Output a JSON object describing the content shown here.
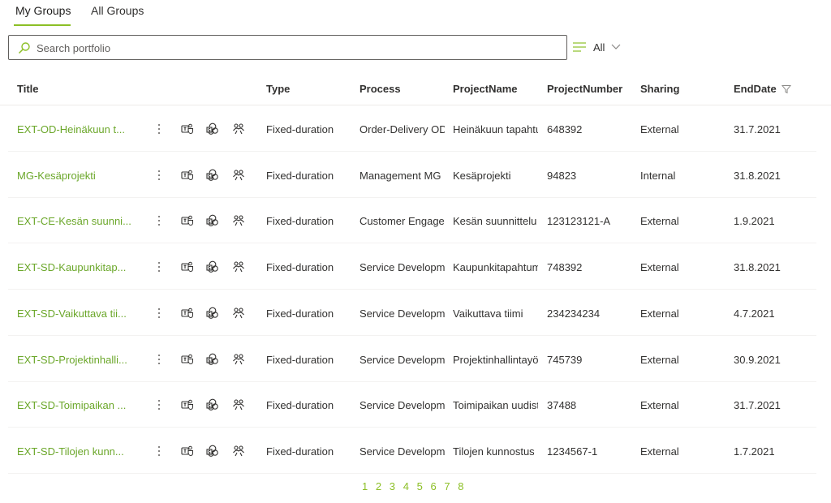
{
  "tabs": [
    {
      "label": "My Groups",
      "active": true
    },
    {
      "label": "All Groups",
      "active": false
    }
  ],
  "search": {
    "placeholder": "Search portfolio",
    "icon": "search-icon"
  },
  "filter": {
    "label": "All"
  },
  "columns": {
    "title": "Title",
    "type": "Type",
    "process": "Process",
    "project_name": "ProjectName",
    "project_number": "ProjectNumber",
    "sharing": "Sharing",
    "end_date": "EndDate"
  },
  "rows": [
    {
      "title": "EXT-OD-Heinäkuun t...",
      "type": "Fixed-duration",
      "process": "Order-Delivery OD",
      "project_name": "Heinäkuun tapahtuma",
      "project_number": "648392",
      "sharing": "External",
      "end_date": "31.7.2021"
    },
    {
      "title": "MG-Kesäprojekti",
      "type": "Fixed-duration",
      "process": "Management MG",
      "project_name": "Kesäprojekti",
      "project_number": "94823",
      "sharing": "Internal",
      "end_date": "31.8.2021"
    },
    {
      "title": "EXT-CE-Kesän suunni...",
      "type": "Fixed-duration",
      "process": "Customer Engagement",
      "project_name": "Kesän suunnittelu",
      "project_number": "123123121-A",
      "sharing": "External",
      "end_date": "1.9.2021"
    },
    {
      "title": "EXT-SD-Kaupunkitap...",
      "type": "Fixed-duration",
      "process": "Service Development",
      "project_name": "Kaupunkitapahtuma",
      "project_number": "748392",
      "sharing": "External",
      "end_date": "31.8.2021"
    },
    {
      "title": "EXT-SD-Vaikuttava tii...",
      "type": "Fixed-duration",
      "process": "Service Development",
      "project_name": "Vaikuttava tiimi",
      "project_number": "234234234",
      "sharing": "External",
      "end_date": "4.7.2021"
    },
    {
      "title": "EXT-SD-Projektinhalli...",
      "type": "Fixed-duration",
      "process": "Service Development",
      "project_name": "Projektinhallintayö",
      "project_number": "745739",
      "sharing": "External",
      "end_date": "30.9.2021"
    },
    {
      "title": "EXT-SD-Toimipaikan ...",
      "type": "Fixed-duration",
      "process": "Service Development",
      "project_name": "Toimipaikan uudistus",
      "project_number": "37488",
      "sharing": "External",
      "end_date": "31.7.2021"
    },
    {
      "title": "EXT-SD-Tilojen kunn...",
      "type": "Fixed-duration",
      "process": "Service Development",
      "project_name": "Tilojen kunnostus",
      "project_number": "1234567-1",
      "sharing": "External",
      "end_date": "1.7.2021"
    }
  ],
  "row_actions": [
    "teams-icon",
    "sharepoint-icon",
    "members-icon"
  ],
  "pagination": [
    "1",
    "2",
    "3",
    "4",
    "5",
    "6",
    "7",
    "8"
  ],
  "colors": {
    "accent": "#8cbf26",
    "link": "#6ba72a",
    "text": "#323130"
  }
}
